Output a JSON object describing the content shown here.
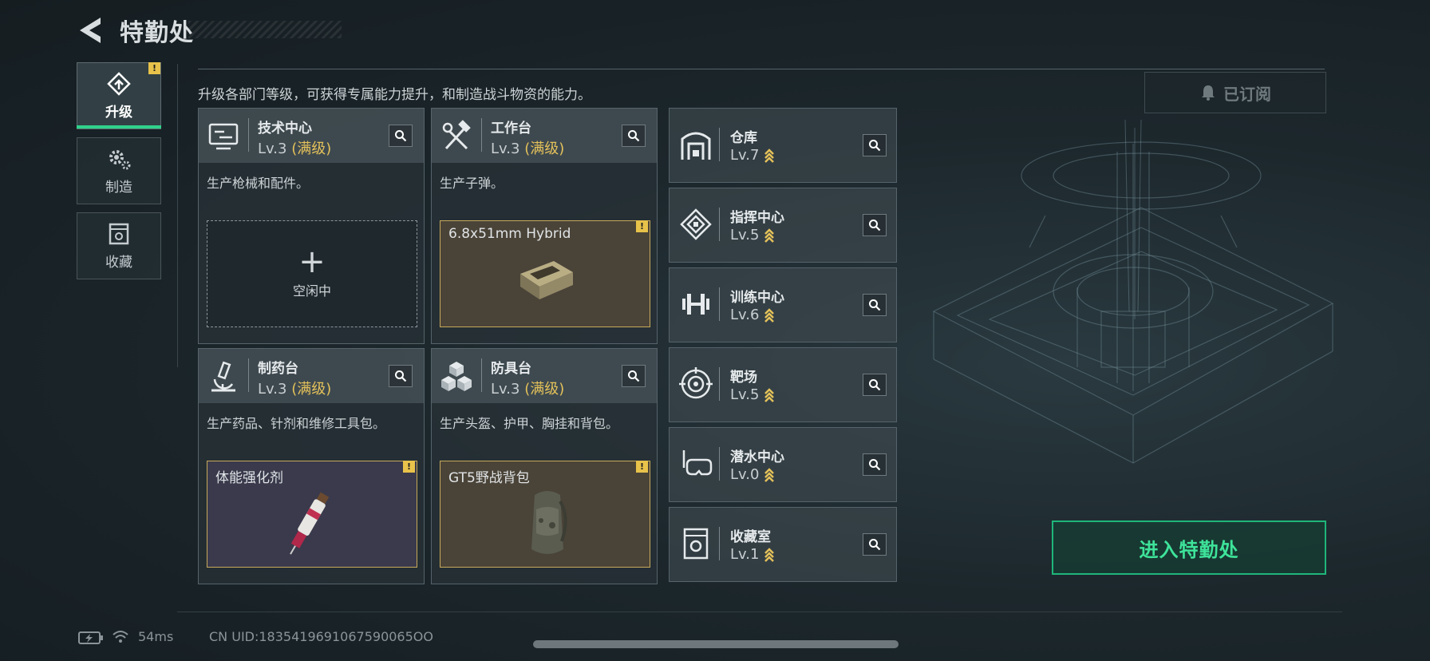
{
  "header": {
    "title": "特勤处",
    "back_icon": "back-arrow-icon"
  },
  "nav": [
    {
      "label": "升级",
      "icon": "upgrade-icon",
      "active": true,
      "alert": "!"
    },
    {
      "label": "制造",
      "icon": "gear-icon",
      "active": false
    },
    {
      "label": "收藏",
      "icon": "collection-icon",
      "active": false
    }
  ],
  "description": "升级各部门等级，可获得专属能力提升，和制造战斗物资的能力。",
  "subscribed_label": "已订阅",
  "departments": [
    {
      "name": "技术中心",
      "level": "Lv.3",
      "max_tag": "(满级)",
      "desc": "生产枪械和配件。",
      "slot": {
        "status": "空闲中"
      },
      "icon": "monitor-icon"
    },
    {
      "name": "工作台",
      "level": "Lv.3",
      "max_tag": "(满级)",
      "desc": "生产子弹。",
      "slot": {
        "item": "6.8x51mm Hybrid",
        "alert": "!"
      },
      "icon": "hammer-wrench-icon"
    },
    {
      "name": "制药台",
      "level": "Lv.3",
      "max_tag": "(满级)",
      "desc": "生产药品、针剂和维修工具包。",
      "slot": {
        "item": "体能强化剂",
        "alert": "!"
      },
      "icon": "microscope-icon"
    },
    {
      "name": "防具台",
      "level": "Lv.3",
      "max_tag": "(满级)",
      "desc": "生产头盔、护甲、胸挂和背包。",
      "slot": {
        "item": "GT5野战背包",
        "alert": "!"
      },
      "icon": "cubes-icon"
    }
  ],
  "facilities": [
    {
      "name": "仓库",
      "level": "Lv.7",
      "icon": "warehouse-icon"
    },
    {
      "name": "指挥中心",
      "level": "Lv.5",
      "icon": "command-icon"
    },
    {
      "name": "训练中心",
      "level": "Lv.6",
      "icon": "dumbbell-icon"
    },
    {
      "name": "靶场",
      "level": "Lv.5",
      "icon": "target-icon"
    },
    {
      "name": "潜水中心",
      "level": "Lv.0",
      "icon": "diving-mask-icon"
    },
    {
      "name": "收藏室",
      "level": "Lv.1",
      "icon": "collection-room-icon"
    }
  ],
  "enter_button": "进入特勤处",
  "status": {
    "ping": "54ms",
    "uid": "CN UID:1835419691067590065OO"
  },
  "colors": {
    "accent_green": "#2fd28a",
    "gold": "#e4c15a",
    "alert": "#e8c24a"
  }
}
